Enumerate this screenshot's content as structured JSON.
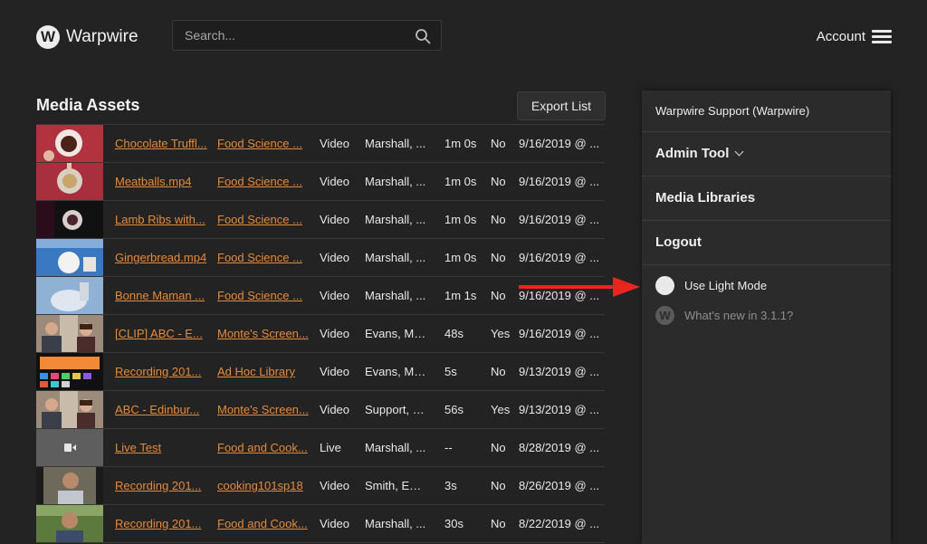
{
  "brand": {
    "logo_letter": "W",
    "name": "Warpwire"
  },
  "search": {
    "placeholder": "Search..."
  },
  "header": {
    "account_label": "Account"
  },
  "main": {
    "title": "Media Assets",
    "export_label": "Export List"
  },
  "colors": {
    "link": "#e58a3b",
    "background": "#232323",
    "panel": "#2b2b2b",
    "annotation_arrow": "#e8251e"
  },
  "rows": [
    {
      "title": "Chocolate Truffl...",
      "library": "Food Science ...",
      "type": "Video",
      "owner": "Marshall, ...",
      "duration": "1m 0s",
      "captions": "No",
      "date": "9/16/2019 @ ...",
      "thumb": "chocolate"
    },
    {
      "title": "Meatballs.mp4",
      "library": "Food Science ...",
      "type": "Video",
      "owner": "Marshall, ...",
      "duration": "1m 0s",
      "captions": "No",
      "date": "9/16/2019 @ ...",
      "thumb": "meatballs"
    },
    {
      "title": "Lamb Ribs with...",
      "library": "Food Science ...",
      "type": "Video",
      "owner": "Marshall, ...",
      "duration": "1m 0s",
      "captions": "No",
      "date": "9/16/2019 @ ...",
      "thumb": "lamb"
    },
    {
      "title": "Gingerbread.mp4",
      "library": "Food Science ...",
      "type": "Video",
      "owner": "Marshall, ...",
      "duration": "1m 0s",
      "captions": "No",
      "date": "9/16/2019 @ ...",
      "thumb": "gingerbread"
    },
    {
      "title": "Bonne Maman ...",
      "library": "Food Science ...",
      "type": "Video",
      "owner": "Marshall, ...",
      "duration": "1m 1s",
      "captions": "No",
      "date": "9/16/2019 @ ...",
      "thumb": "bonne"
    },
    {
      "title": "[CLIP] ABC - E...",
      "library": "Monte's Screen...",
      "type": "Video",
      "owner": "Evans, Mo...",
      "duration": "48s",
      "captions": "Yes",
      "date": "9/16/2019 @ ...",
      "thumb": "people"
    },
    {
      "title": "Recording 201...",
      "library": "Ad Hoc Library",
      "type": "Video",
      "owner": "Evans, Mo...",
      "duration": "5s",
      "captions": "No",
      "date": "9/13/2019 @ ...",
      "thumb": "screen"
    },
    {
      "title": "ABC - Edinbur...",
      "library": "Monte's Screen...",
      "type": "Video",
      "owner": "Support, W...",
      "duration": "56s",
      "captions": "Yes",
      "date": "9/13/2019 @ ...",
      "thumb": "people"
    },
    {
      "title": "Live Test",
      "library": "Food and Cook...",
      "type": "Live",
      "owner": "Marshall, ...",
      "duration": "--",
      "captions": "No",
      "date": "8/28/2019 @ ...",
      "thumb": "live"
    },
    {
      "title": "Recording 201...",
      "library": "cooking101sp18",
      "type": "Video",
      "owner": "Smith, Emile",
      "duration": "3s",
      "captions": "No",
      "date": "8/26/2019 @ ...",
      "thumb": "webcam"
    },
    {
      "title": "Recording 201...",
      "library": "Food and Cook...",
      "type": "Video",
      "owner": "Marshall, ...",
      "duration": "30s",
      "captions": "No",
      "date": "8/22/2019 @ ...",
      "thumb": "webcam2"
    }
  ],
  "menu": {
    "user": "Warpwire Support (Warpwire)",
    "admin_tool": "Admin Tool",
    "media_libraries": "Media Libraries",
    "logout": "Logout",
    "light_mode": "Use Light Mode",
    "whats_new_letter": "W",
    "whats_new": "What's new in 3.1.1?"
  }
}
